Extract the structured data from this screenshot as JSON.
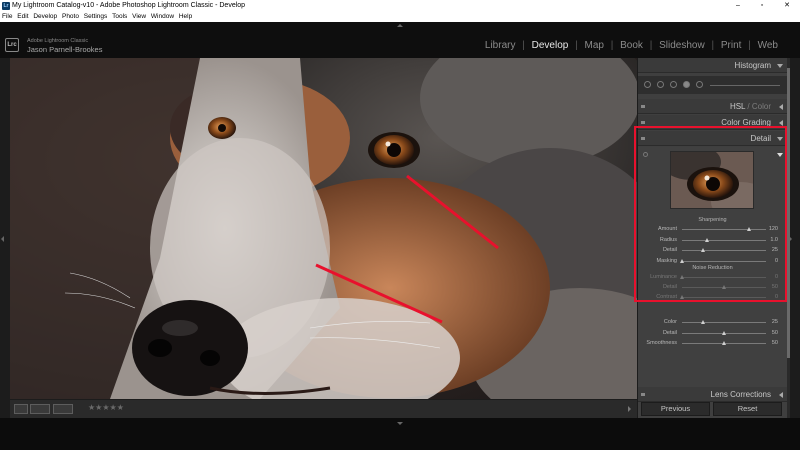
{
  "window": {
    "title": "My Lightroom Catalog-v10 - Adobe Photoshop Lightroom Classic - Develop",
    "app_icon": "Lr",
    "minimize": "–",
    "maximize": "▫",
    "close": "✕"
  },
  "menu": [
    "File",
    "Edit",
    "Develop",
    "Photo",
    "Settings",
    "Tools",
    "View",
    "Window",
    "Help"
  ],
  "identity": {
    "badge": "Lrc",
    "line1": "Adobe Lightroom Classic",
    "line2": "Jason Parnell-Brookes"
  },
  "modules": {
    "items": [
      "Library",
      "Develop",
      "Map",
      "Book",
      "Slideshow",
      "Print",
      "Web"
    ],
    "active": "Develop",
    "separator": "|"
  },
  "toolbar": {
    "stars": "★★★★★"
  },
  "panels": {
    "histogram": "Histogram",
    "hsl": "HSL",
    "hsl_sep": " / ",
    "color": "Color",
    "color_grading": "Color Grading",
    "detail": "Detail",
    "lens_corrections": "Lens Corrections"
  },
  "sharpening": {
    "heading": "Sharpening",
    "rows": [
      {
        "label": "Amount",
        "value": "120",
        "level": 0.8
      },
      {
        "label": "Radius",
        "value": "1.0",
        "level": 0.3
      },
      {
        "label": "Detail",
        "value": "25",
        "level": 0.25
      },
      {
        "label": "Masking",
        "value": "0",
        "level": 0.0
      }
    ]
  },
  "noise_reduction": {
    "heading": "Noise Reduction",
    "rows": [
      {
        "label": "Luminance",
        "value": "0",
        "level": 0.0
      },
      {
        "label": "Detail",
        "value": "50",
        "level": 0.5
      },
      {
        "label": "Contrast",
        "value": "0",
        "level": 0.0
      },
      {
        "label": "Color",
        "value": "25",
        "level": 0.25
      },
      {
        "label": "Detail",
        "value": "50",
        "level": 0.5
      },
      {
        "label": "Smoothness",
        "value": "50",
        "level": 0.5
      }
    ]
  },
  "buttons": {
    "previous": "Previous",
    "reset": "Reset"
  },
  "colors": {
    "highlight_box": "#e8112d",
    "annotation_lines": "#e8112d"
  }
}
